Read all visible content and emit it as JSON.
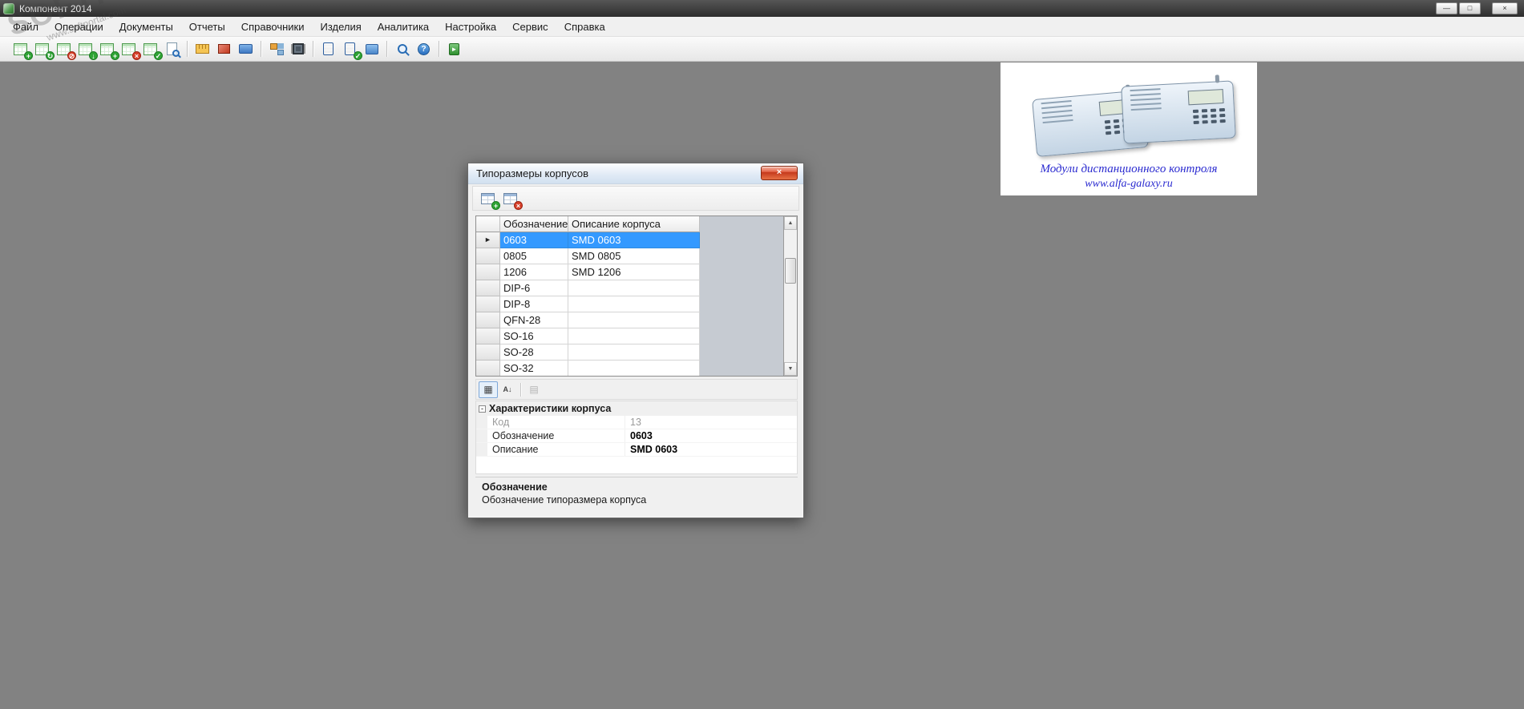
{
  "window": {
    "title": "Компонент 2014"
  },
  "menu": {
    "items": [
      "Файл",
      "Операции",
      "Документы",
      "Отчеты",
      "Справочники",
      "Изделия",
      "Аналитика",
      "Настройка",
      "Сервис",
      "Справка"
    ]
  },
  "glyphs": {
    "minimize": "—",
    "maximize": "□",
    "close": "×",
    "plus": "+",
    "cross": "×",
    "check": "✓",
    "block": "⊘",
    "sync": "↻",
    "down": "↓",
    "question": "?",
    "arrow_right": "►",
    "scroll_up": "▲",
    "scroll_down": "▼",
    "categorized": "▦",
    "sort": "A↓",
    "pages": "▤",
    "collapse": "-"
  },
  "toolbar": {
    "icons": [
      "calendar-add",
      "calendar-refresh",
      "calendar-block",
      "calendar-download",
      "calendar-add-2",
      "calendar-cancel",
      "calendar-check",
      "document-search",
      "ruler",
      "box",
      "truck",
      "tree",
      "chip",
      "cabinet",
      "cabinet-check",
      "computer",
      "search-info",
      "help",
      "exit"
    ]
  },
  "watermark": {
    "line1": "SOFTPORTAL",
    "line2": "www.softportal.com"
  },
  "ad": {
    "line1": "Модули дистанционного контроля",
    "line2": "www.alfa-galaxy.ru"
  },
  "dialog": {
    "title": "Типоразмеры корпусов",
    "table": {
      "columns": [
        "Обозначение",
        "Описание корпуса"
      ],
      "rows": [
        {
          "code": "0603",
          "desc": "SMD 0603"
        },
        {
          "code": "0805",
          "desc": "SMD 0805"
        },
        {
          "code": "1206",
          "desc": "SMD 1206"
        },
        {
          "code": "DIP-6",
          "desc": ""
        },
        {
          "code": "DIP-8",
          "desc": ""
        },
        {
          "code": "QFN-28",
          "desc": ""
        },
        {
          "code": "SO-16",
          "desc": ""
        },
        {
          "code": "SO-28",
          "desc": ""
        },
        {
          "code": "SO-32",
          "desc": ""
        }
      ]
    },
    "properties": {
      "category": "Характеристики корпуса",
      "rows": [
        {
          "name": "Код",
          "value": "13"
        },
        {
          "name": "Обозначение",
          "value": "0603"
        },
        {
          "name": "Описание",
          "value": "SMD 0603"
        }
      ]
    },
    "help": {
      "title": "Обозначение",
      "text": "Обозначение типоразмера корпуса"
    }
  }
}
